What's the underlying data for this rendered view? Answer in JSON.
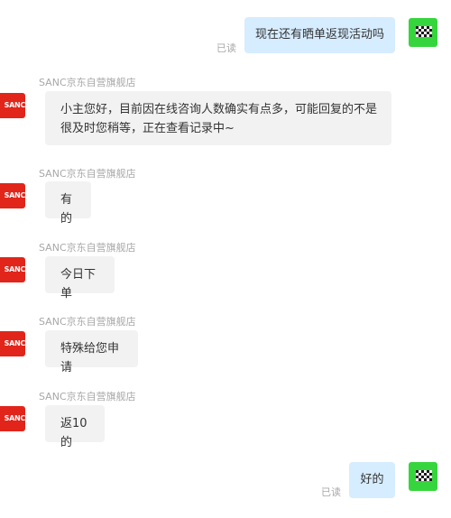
{
  "messages": [
    {
      "side": "out",
      "text": "现在还有晒单返现活动吗",
      "status": "已读"
    },
    {
      "side": "in",
      "sender": "SANC京东自营旗舰店",
      "text": "小主您好，目前因在线咨询人数确实有点多，可能回复的不是很及时您稍等，正在查看记录中~"
    },
    {
      "side": "in",
      "sender": "SANC京东自营旗舰店",
      "text": "有的"
    },
    {
      "side": "in",
      "sender": "SANC京东自营旗舰店",
      "text": "今日下单"
    },
    {
      "side": "in",
      "sender": "SANC京东自营旗舰店",
      "text": "特殊给您申请"
    },
    {
      "side": "in",
      "sender": "SANC京东自营旗舰店",
      "text": "返10的"
    },
    {
      "side": "out",
      "text": "好的",
      "status": "已读"
    }
  ],
  "shop_avatar_text": "SANC",
  "colors": {
    "outgoing_bubble": "#d6ecff",
    "incoming_bubble": "#f2f2f2",
    "shop_avatar": "#e1251b",
    "user_avatar": "#36d53d",
    "meta_text": "#a8a8a8"
  },
  "icons": {
    "user_avatar": "checkered-flag-icon",
    "shop_avatar": "shop-logo"
  }
}
